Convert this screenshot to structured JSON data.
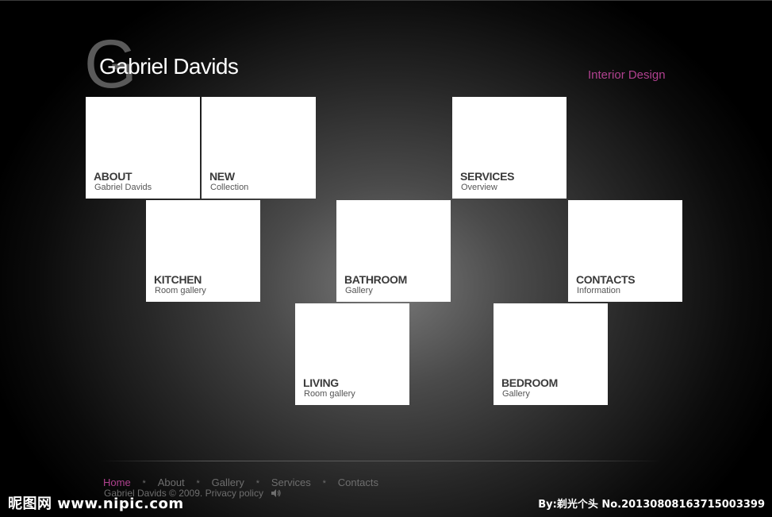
{
  "brand": {
    "logo_letter": "G",
    "name": "Gabriel Davids",
    "tagline": "Interior Design"
  },
  "tiles": [
    {
      "title": "ABOUT",
      "subtitle": "Gabriel Davids"
    },
    {
      "title": "NEW",
      "subtitle": "Collection"
    },
    {
      "title": "SERVICES",
      "subtitle": "Overview"
    },
    {
      "title": "KITCHEN",
      "subtitle": "Room gallery"
    },
    {
      "title": "BATHROOM",
      "subtitle": "Gallery"
    },
    {
      "title": "CONTACTS",
      "subtitle": "Information"
    },
    {
      "title": "LIVING",
      "subtitle": "Room gallery"
    },
    {
      "title": "BEDROOM",
      "subtitle": "Gallery"
    }
  ],
  "footer": {
    "nav": [
      "Home",
      "About",
      "Gallery",
      "Services",
      "Contacts"
    ],
    "separator": "*",
    "active": "Home",
    "copyright": "Gabriel Davids  ©  2009.",
    "privacy": "Privacy policy"
  },
  "watermark": {
    "left": "昵图网 www.nipic.com",
    "right": "By:剃光个头 No.20130808163715003399"
  },
  "colors": {
    "accent": "#b0418f",
    "tile": "#ffffff",
    "footer_text": "#6e6e6e"
  },
  "icons": {
    "speaker": "speaker-icon"
  }
}
